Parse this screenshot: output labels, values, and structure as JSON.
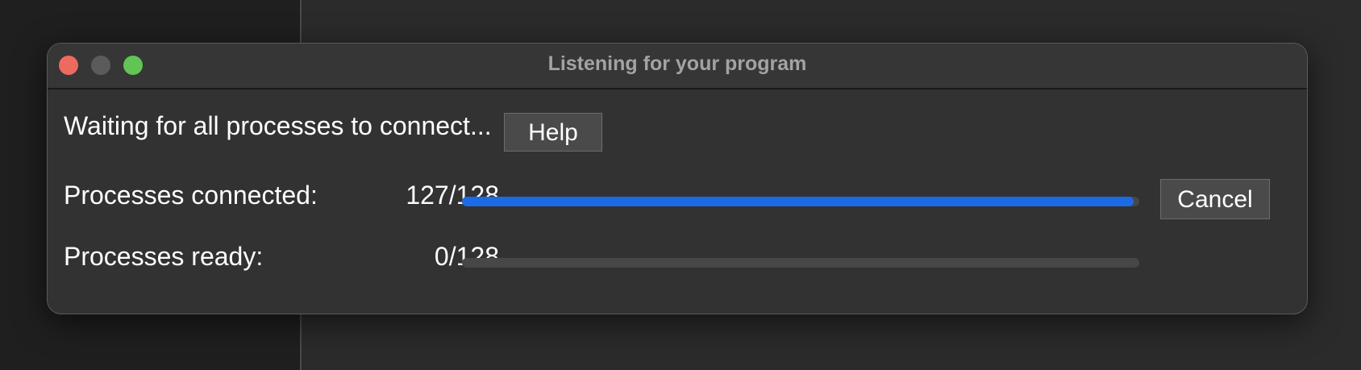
{
  "window": {
    "title": "Listening for your program"
  },
  "status": {
    "message": "Waiting for all processes to connect...",
    "help_label": "Help",
    "cancel_label": "Cancel"
  },
  "progress": {
    "connected": {
      "label": "Processes connected:",
      "count_text": "127/128",
      "value": 127,
      "total": 128
    },
    "ready": {
      "label": "Processes ready:",
      "count_text": "0/128",
      "value": 0,
      "total": 128
    }
  },
  "colors": {
    "progress_fill": "#1d6ae5",
    "close_light": "#ed6a5e",
    "minimize_light": "#5b5b5b",
    "zoom_light": "#61c454"
  }
}
